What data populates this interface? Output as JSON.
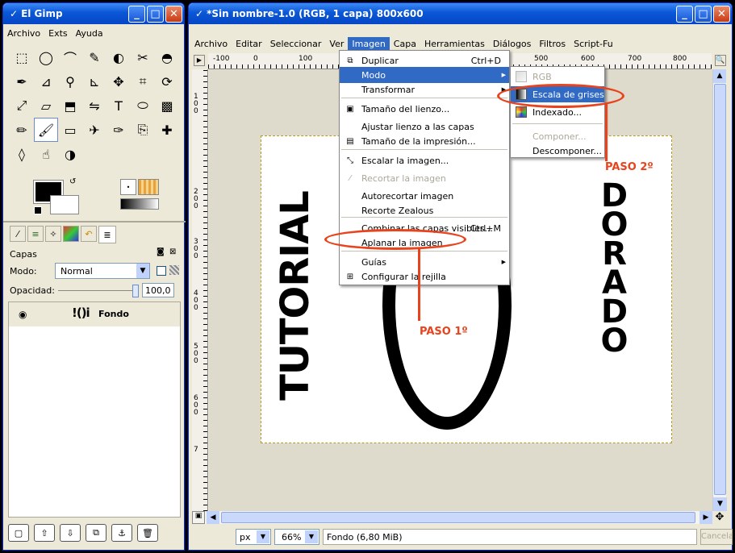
{
  "toolbox": {
    "title": "El Gimp",
    "menu": [
      "Archivo",
      "Exts",
      "Ayuda"
    ],
    "tool_icons": [
      "rect-select",
      "ellipse-select",
      "free-select",
      "fuzzy-select",
      "color-select",
      "scissors",
      "foreground-select",
      "paths",
      "color-picker",
      "zoom",
      "measure",
      "move",
      "crop",
      "rotate",
      "scale",
      "shear",
      "perspective",
      "flip",
      "text",
      "bucket-fill",
      "blend",
      "pencil",
      "paintbrush",
      "eraser",
      "airbrush",
      "ink",
      "clone",
      "heal",
      "convolve",
      "smudge",
      "dodge"
    ]
  },
  "layers": {
    "panel_title": "Capas",
    "mode_label": "Modo:",
    "mode_value": "Normal",
    "opacity_label": "Opacidad:",
    "opacity_value": "100,0",
    "layer_name": "Fondo",
    "thumb_text": "!()i"
  },
  "image_window": {
    "title": "*Sin nombre-1.0 (RGB, 1 capa) 800x600",
    "menu": [
      "Archivo",
      "Editar",
      "Seleccionar",
      "Ver",
      "Imagen",
      "Capa",
      "Herramientas",
      "Diálogos",
      "Filtros",
      "Script-Fu"
    ],
    "active_menu": "Imagen",
    "ruler_h": [
      "-100",
      "0",
      "100",
      "500",
      "600",
      "700",
      "800"
    ],
    "ruler_v": [
      "1 0 0",
      "2 0 0",
      "3 0 0",
      "4 0 0",
      "5 0 0",
      "6 0 0",
      "7"
    ],
    "status": {
      "unit": "px",
      "zoom": "66%",
      "info": "Fondo (6,80 MiB)",
      "cancel": "Cancelar"
    }
  },
  "canvas": {
    "left_text": "TUTORIAL",
    "right_text": "DORADO"
  },
  "imagen_menu": [
    {
      "label": "Duplicar",
      "accel": "Ctrl+D",
      "icon": "duplicate-icon"
    },
    {
      "label": "Modo",
      "highlight": true,
      "submenu": true
    },
    {
      "label": "Transformar",
      "submenu": true
    },
    {
      "label": "Tamaño del lienzo...",
      "icon": "canvas-size-icon"
    },
    {
      "label": "Ajustar lienzo a las capas"
    },
    {
      "label": "Tamaño de la impresión...",
      "icon": "print-size-icon"
    },
    {
      "label": "Escalar la imagen...",
      "icon": "scale-icon"
    },
    {
      "label": "Recortar la imagen",
      "disabled": true,
      "icon": "crop-icon"
    },
    {
      "label": "Autorecortar imagen"
    },
    {
      "label": "Recorte Zealous"
    },
    {
      "label": "Combinar las capas visibles...",
      "accel": "Ctrl+M"
    },
    {
      "label": "Aplanar la imagen"
    },
    {
      "label": "Guías",
      "submenu": true
    },
    {
      "label": "Configurar la rejilla",
      "icon": "grid-icon"
    }
  ],
  "modo_submenu": [
    {
      "label": "RGB",
      "disabled": true
    },
    {
      "label": "Escala de grises",
      "highlight": true
    },
    {
      "label": "Indexado..."
    },
    {
      "label": "Componer...",
      "disabled": true
    },
    {
      "label": "Descomponer..."
    }
  ],
  "annotations": {
    "step1": "PASO 1º",
    "step2": "PASO 2º",
    "color": "#e8431c"
  }
}
